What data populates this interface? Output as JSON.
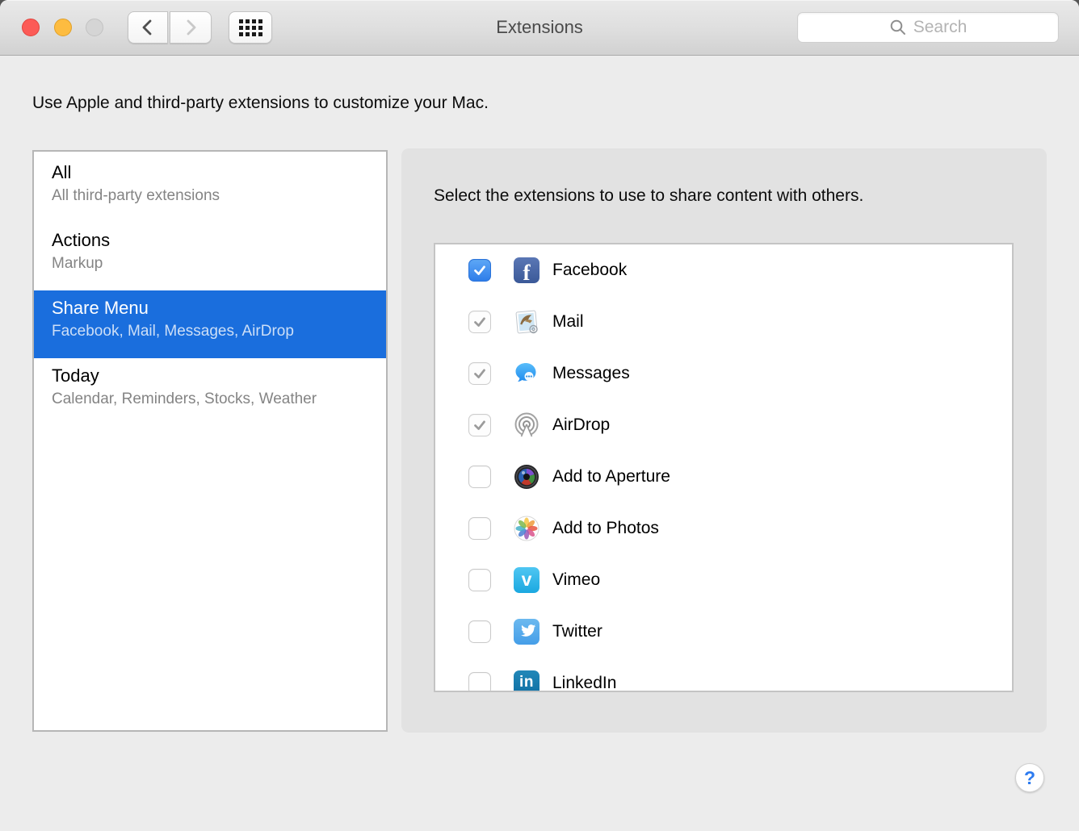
{
  "window": {
    "title": "Extensions"
  },
  "toolbar": {
    "close": "close",
    "minimize": "minimize",
    "zoom": "zoom",
    "search_placeholder": "Search"
  },
  "intro": "Use Apple and third-party extensions to customize your Mac.",
  "sidebar": {
    "items": [
      {
        "title": "All",
        "subtitle": "All third-party extensions",
        "selected": false
      },
      {
        "title": "Actions",
        "subtitle": "Markup",
        "selected": false
      },
      {
        "title": "Share Menu",
        "subtitle": "Facebook, Mail, Messages, AirDrop",
        "selected": true
      },
      {
        "title": "Today",
        "subtitle": "Calendar, Reminders, Stocks, Weather",
        "selected": false
      }
    ]
  },
  "main": {
    "heading": "Select the extensions to use to share content with others.",
    "extensions": [
      {
        "label": "Facebook",
        "icon": "facebook-icon",
        "checked": true,
        "enabled": true
      },
      {
        "label": "Mail",
        "icon": "mail-icon",
        "checked": true,
        "enabled": false
      },
      {
        "label": "Messages",
        "icon": "messages-icon",
        "checked": true,
        "enabled": false
      },
      {
        "label": "AirDrop",
        "icon": "airdrop-icon",
        "checked": true,
        "enabled": false
      },
      {
        "label": "Add to Aperture",
        "icon": "aperture-icon",
        "checked": false,
        "enabled": true
      },
      {
        "label": "Add to Photos",
        "icon": "photos-icon",
        "checked": false,
        "enabled": true
      },
      {
        "label": "Vimeo",
        "icon": "vimeo-icon",
        "checked": false,
        "enabled": true
      },
      {
        "label": "Twitter",
        "icon": "twitter-icon",
        "checked": false,
        "enabled": true
      },
      {
        "label": "LinkedIn",
        "icon": "linkedin-icon",
        "checked": false,
        "enabled": true
      }
    ]
  },
  "help": {
    "label": "?"
  },
  "colors": {
    "selection_blue": "#1a6edd",
    "checkbox_blue": "#2e7de9",
    "window_bg": "#ececec",
    "panel_bg": "#e2e2e2",
    "titlebar_top": "#e9e9e9",
    "titlebar_bottom": "#d1d1d1",
    "help_blue": "#2d7bf0"
  }
}
